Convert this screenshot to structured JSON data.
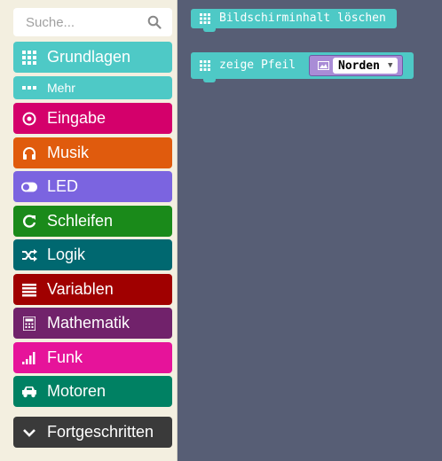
{
  "search": {
    "placeholder": "Suche..."
  },
  "categories": [
    {
      "label": "Grundlagen",
      "color": "#4ec9c6",
      "icon": "grid-icon"
    },
    {
      "label": "Mehr",
      "color": "#4ec9c6",
      "icon": "more-dots-icon"
    },
    {
      "label": "Eingabe",
      "color": "#d4006b",
      "icon": "target-icon"
    },
    {
      "label": "Musik",
      "color": "#e05b0d",
      "icon": "headphones-icon"
    },
    {
      "label": "LED",
      "color": "#7b64e0",
      "icon": "toggle-icon"
    },
    {
      "label": "Schleifen",
      "color": "#1a8a1a",
      "icon": "refresh-icon"
    },
    {
      "label": "Logik",
      "color": "#006870",
      "icon": "shuffle-icon"
    },
    {
      "label": "Variablen",
      "color": "#a00000",
      "icon": "list-icon"
    },
    {
      "label": "Mathematik",
      "color": "#71226b",
      "icon": "calculator-icon"
    },
    {
      "label": "Funk",
      "color": "#e6139a",
      "icon": "signal-icon"
    },
    {
      "label": "Motoren",
      "color": "#008163",
      "icon": "car-icon"
    },
    {
      "label": "Fortgeschritten",
      "color": "#3a3a3a",
      "icon": "chevron-down-icon"
    }
  ],
  "workspace": {
    "block1": {
      "label": "Bildschirminhalt löschen",
      "color": "#4ec9c6"
    },
    "block2": {
      "label": "zeige Pfeil",
      "color": "#4ec9c6",
      "field_color": "#a98cd6",
      "dropdown_value": "Norden"
    }
  }
}
